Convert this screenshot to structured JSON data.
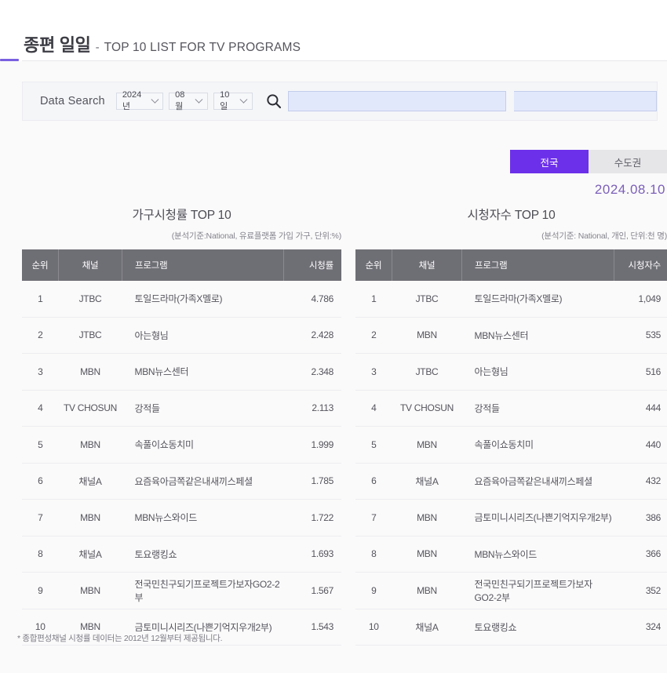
{
  "header": {
    "title_ko": "종편 일일",
    "title_dash": "-",
    "title_en": "TOP 10 LIST FOR TV PROGRAMS"
  },
  "search": {
    "label": "Data Search",
    "year": "2024년",
    "month": "08월",
    "day": "10일",
    "search_icon": "search-icon",
    "keyword_value": "",
    "keyword_placeholder": ""
  },
  "region": {
    "tabs": [
      {
        "label": "전국",
        "active": true
      },
      {
        "label": "수도권",
        "active": false
      }
    ],
    "active_color": "#6d30ea",
    "inactive_color": "#e6e6e8"
  },
  "date_label": "2024.08.10",
  "tables": [
    {
      "title": "가구시청률 TOP 10",
      "subtitle": "(분석기준:National, 유료플랫폼 가입 가구, 단위:%)",
      "columns": [
        "순위",
        "채널",
        "프로그램",
        "시청률"
      ],
      "rows": [
        {
          "rank": "1",
          "channel": "JTBC",
          "program": "토일드라마(가족X멜로)",
          "value": "4.786"
        },
        {
          "rank": "2",
          "channel": "JTBC",
          "program": "아는형님",
          "value": "2.428"
        },
        {
          "rank": "3",
          "channel": "MBN",
          "program": "MBN뉴스센터",
          "value": "2.348"
        },
        {
          "rank": "4",
          "channel": "TV CHOSUN",
          "program": "강적들",
          "value": "2.113"
        },
        {
          "rank": "5",
          "channel": "MBN",
          "program": "속풀이쇼동치미",
          "value": "1.999"
        },
        {
          "rank": "6",
          "channel": "채널A",
          "program": "요즘육아금쪽같은내새끼스페셜",
          "value": "1.785"
        },
        {
          "rank": "7",
          "channel": "MBN",
          "program": "MBN뉴스와이드",
          "value": "1.722"
        },
        {
          "rank": "8",
          "channel": "채널A",
          "program": "토요랭킹쇼",
          "value": "1.693"
        },
        {
          "rank": "9",
          "channel": "MBN",
          "program": "전국민친구되기프로젝트가보자GO2-2부",
          "value": "1.567"
        },
        {
          "rank": "10",
          "channel": "MBN",
          "program": "금토미니시리즈(나쁜기억지우개2부)",
          "value": "1.543"
        }
      ]
    },
    {
      "title": "시청자수 TOP 10",
      "subtitle": "(분석기준: National, 개인, 단위:천 명)",
      "columns": [
        "순위",
        "채널",
        "프로그램",
        "시청자수"
      ],
      "rows": [
        {
          "rank": "1",
          "channel": "JTBC",
          "program": "토일드라마(가족X멜로)",
          "value": "1,049"
        },
        {
          "rank": "2",
          "channel": "MBN",
          "program": "MBN뉴스센터",
          "value": "535"
        },
        {
          "rank": "3",
          "channel": "JTBC",
          "program": "아는형님",
          "value": "516"
        },
        {
          "rank": "4",
          "channel": "TV CHOSUN",
          "program": "강적들",
          "value": "444"
        },
        {
          "rank": "5",
          "channel": "MBN",
          "program": "속풀이쇼동치미",
          "value": "440"
        },
        {
          "rank": "6",
          "channel": "채널A",
          "program": "요즘육아금쪽같은내새끼스페셜",
          "value": "432"
        },
        {
          "rank": "7",
          "channel": "MBN",
          "program": "금토미니시리즈(나쁜기억지우개2부)",
          "value": "386"
        },
        {
          "rank": "8",
          "channel": "MBN",
          "program": "MBN뉴스와이드",
          "value": "366"
        },
        {
          "rank": "9",
          "channel": "MBN",
          "program": "전국민친구되기프로젝트가보자GO2-2부",
          "value": "352"
        },
        {
          "rank": "10",
          "channel": "채널A",
          "program": "토요랭킹쇼",
          "value": "324"
        }
      ]
    }
  ],
  "footnote": "* 종합편성채널 시청률 데이터는 2012년 12월부터 제공됩니다.",
  "chart_data": {
    "type": "table",
    "title": "종편 일일 - TOP 10 LIST FOR TV PROGRAMS",
    "date": "2024.08.10",
    "region": "전국",
    "tables": [
      {
        "title": "가구시청률 TOP 10",
        "unit": "%",
        "basis": "National, 유료플랫폼 가입 가구",
        "categories": [
          "토일드라마(가족X멜로)",
          "아는형님",
          "MBN뉴스센터",
          "강적들",
          "속풀이쇼동치미",
          "요즘육아금쪽같은내새끼스페셜",
          "MBN뉴스와이드",
          "토요랭킹쇼",
          "전국민친구되기프로젝트가보자GO2-2부",
          "금토미니시리즈(나쁜기억지우개2부)"
        ],
        "values": [
          4.786,
          2.428,
          2.348,
          2.113,
          1.999,
          1.785,
          1.722,
          1.693,
          1.567,
          1.543
        ],
        "channels": [
          "JTBC",
          "JTBC",
          "MBN",
          "TV CHOSUN",
          "MBN",
          "채널A",
          "MBN",
          "채널A",
          "MBN",
          "MBN"
        ]
      },
      {
        "title": "시청자수 TOP 10",
        "unit": "천 명",
        "basis": "National, 개인",
        "categories": [
          "토일드라마(가족X멜로)",
          "MBN뉴스센터",
          "아는형님",
          "강적들",
          "속풀이쇼동치미",
          "요즘육아금쪽같은내새끼스페셜",
          "금토미니시리즈(나쁜기억지우개2부)",
          "MBN뉴스와이드",
          "전국민친구되기프로젝트가보자GO2-2부",
          "토요랭킹쇼"
        ],
        "values": [
          1049,
          535,
          516,
          444,
          440,
          432,
          386,
          366,
          352,
          324
        ],
        "channels": [
          "JTBC",
          "MBN",
          "JTBC",
          "TV CHOSUN",
          "MBN",
          "채널A",
          "MBN",
          "MBN",
          "MBN",
          "채널A"
        ]
      }
    ]
  }
}
